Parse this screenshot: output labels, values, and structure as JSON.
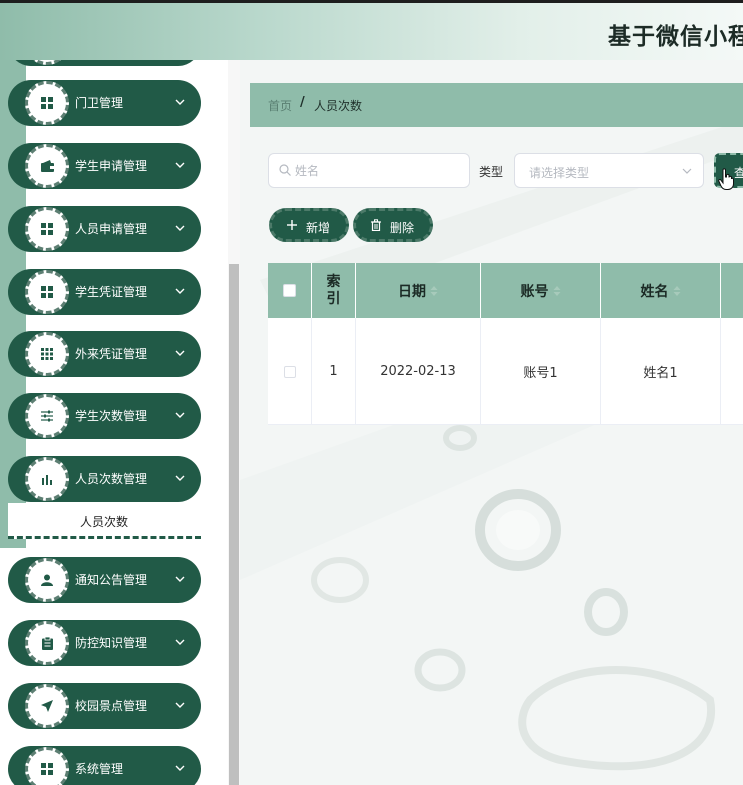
{
  "header": {
    "title": "基于微信小程"
  },
  "sidebar": {
    "items": [
      {
        "label": "门卫管理",
        "icon": "grid-icon"
      },
      {
        "label": "学生申请管理",
        "icon": "wallet-icon"
      },
      {
        "label": "人员申请管理",
        "icon": "grid-icon"
      },
      {
        "label": "学生凭证管理",
        "icon": "grid-icon"
      },
      {
        "label": "外来凭证管理",
        "icon": "apps-icon"
      },
      {
        "label": "学生次数管理",
        "icon": "sliders-icon"
      },
      {
        "label": "人员次数管理",
        "icon": "bar-chart-icon"
      },
      {
        "label": "通知公告管理",
        "icon": "user-icon"
      },
      {
        "label": "防控知识管理",
        "icon": "clipboard-icon"
      },
      {
        "label": "校园景点管理",
        "icon": "send-icon"
      },
      {
        "label": "系统管理",
        "icon": "grid-icon"
      }
    ],
    "submenu": {
      "label": "人员次数"
    }
  },
  "breadcrumb": {
    "home": "首页",
    "separator": "/",
    "current": "人员次数"
  },
  "search": {
    "name_placeholder": "姓名",
    "type_label": "类型",
    "type_placeholder": "请选择类型",
    "query_label": "查"
  },
  "actions": {
    "add_label": "新增",
    "delete_label": "删除"
  },
  "table": {
    "headers": {
      "index_line1": "索",
      "index_line2": "引",
      "date": "日期",
      "account": "账号",
      "name": "姓名"
    },
    "rows": [
      {
        "index": "1",
        "date": "2022-02-13",
        "account": "账号1",
        "name": "姓名1"
      }
    ]
  },
  "colors": {
    "primary": "#215a47",
    "accent": "#8fbcaa",
    "header_text": "#1c2b26"
  }
}
